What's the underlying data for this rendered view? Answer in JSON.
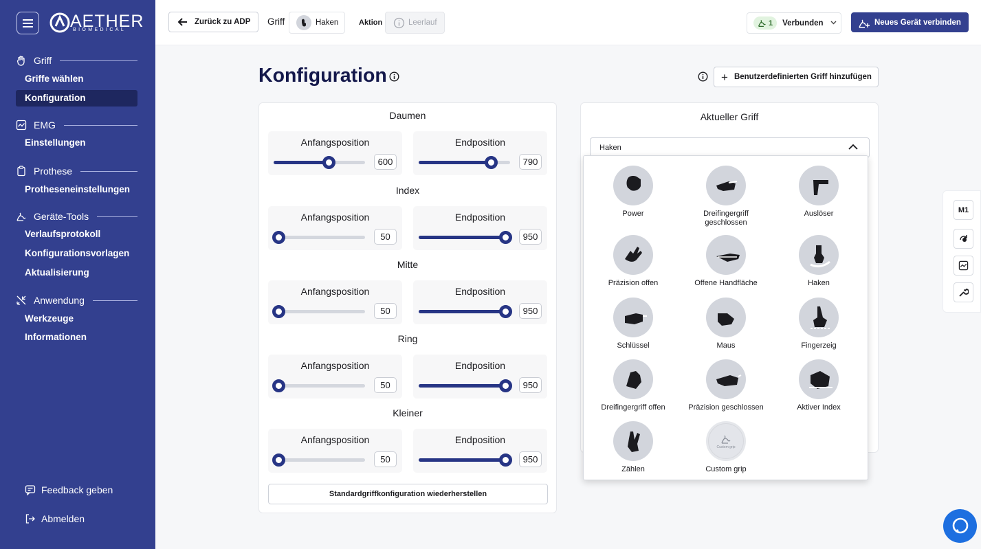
{
  "brand": {
    "name": "AETHER",
    "sub": "BIOMEDICAL"
  },
  "sidebar": {
    "sections": [
      {
        "label": "Griff",
        "icon": "hand-icon",
        "items": [
          "Griffe wählen",
          "Konfiguration"
        ]
      },
      {
        "label": "EMG",
        "icon": "chart-icon",
        "items": [
          "Einstellungen"
        ]
      },
      {
        "label": "Prothese",
        "icon": "clipboard-icon",
        "items": [
          "Protheseneinstellungen"
        ]
      },
      {
        "label": "Geräte-Tools",
        "icon": "arm-icon",
        "items": [
          "Verlaufsprotokoll",
          "Konfigurationsvorlagen",
          "Aktualisierung"
        ]
      },
      {
        "label": "Anwendung",
        "icon": "tools-icon",
        "items": [
          "Werkzeuge",
          "Informationen"
        ]
      }
    ],
    "active_item": "Konfiguration",
    "feedback": "Feedback geben",
    "logout": "Abmelden"
  },
  "topbar": {
    "back": "Zurück zu ADP",
    "griff_label": "Griff",
    "griff_value": "Haken",
    "aktion_label": "Aktion",
    "aktion_value": "Leerlauf",
    "connected_count": "1",
    "connected_label": "Verbunden",
    "new_device": "Neues Gerät verbinden"
  },
  "main": {
    "title": "Konfiguration",
    "add_custom": "Benutzerdefinierten Griff hinzufügen",
    "start_label": "Anfangsposition",
    "end_label": "Endposition",
    "fingers": [
      {
        "name": "Daumen",
        "start": 600,
        "end": 790
      },
      {
        "name": "Index",
        "start": 50,
        "end": 950
      },
      {
        "name": "Mitte",
        "start": 50,
        "end": 950
      },
      {
        "name": "Ring",
        "start": 50,
        "end": 950
      },
      {
        "name": "Kleiner",
        "start": 50,
        "end": 950
      }
    ],
    "slider_max": 1000,
    "reset": "Standardgriffkonfiguration wiederherstellen"
  },
  "current": {
    "title": "Aktueller Griff",
    "selected": "Haken",
    "options": [
      "Power",
      "Dreifingergriff geschlossen",
      "Auslöser",
      "Präzision offen",
      "Offene Handfläche",
      "Haken",
      "Schlüssel",
      "Maus",
      "Fingerzeig",
      "Dreifingergriff offen",
      "Präzision geschlossen",
      "Aktiver Index",
      "Zählen",
      "Custom grip"
    ],
    "custom_tiny": "Custom grip"
  },
  "rail": {
    "m1": "M1"
  },
  "colors": {
    "primary": "#33408f",
    "slider": "#273585",
    "title": "#14184b",
    "chat": "#1d6fe0"
  }
}
